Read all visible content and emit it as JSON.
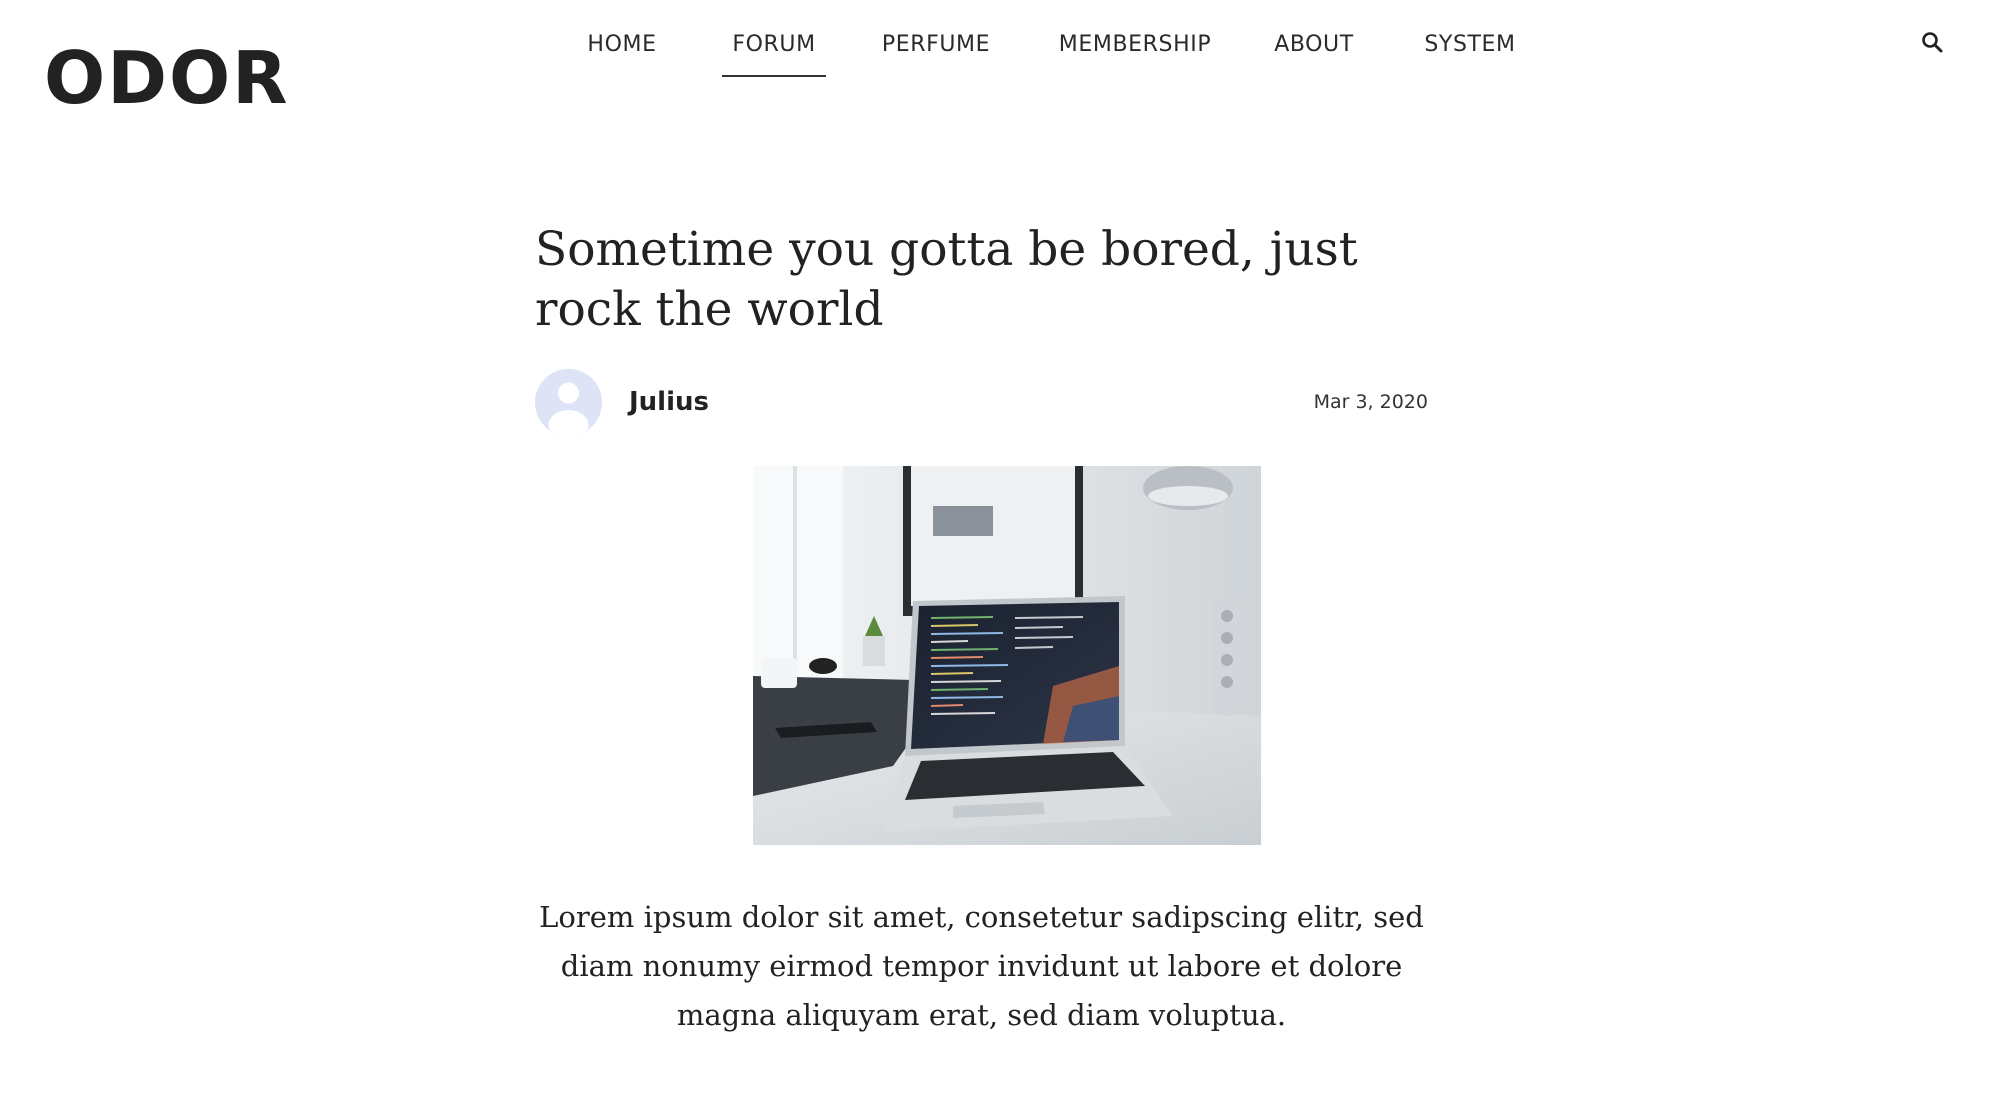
{
  "header": {
    "logo": "ODOR",
    "nav": [
      {
        "label": "HOME",
        "active": false
      },
      {
        "label": "FORUM",
        "active": true
      },
      {
        "label": "PERFUME",
        "active": false
      },
      {
        "label": "MEMBERSHIP",
        "active": false
      },
      {
        "label": "ABOUT",
        "active": false
      },
      {
        "label": "SYSTEM",
        "active": false
      }
    ],
    "search_icon": "search-icon"
  },
  "article": {
    "title": "Sometime you gotta be bored, just rock the world",
    "author": "Julius",
    "date": "Mar 3, 2020",
    "avatar_icon": "user-avatar-icon",
    "image": "laptop-on-desk-photo",
    "body": "Lorem ipsum dolor sit amet, consetetur sadipscing elitr, sed diam nonumy eirmod tempor invidunt ut labore et dolore magna aliquyam erat, sed diam voluptua."
  },
  "colors": {
    "text": "#222222",
    "avatar_bg": "#dfe3f6",
    "avatar_fg": "#ffffff"
  }
}
